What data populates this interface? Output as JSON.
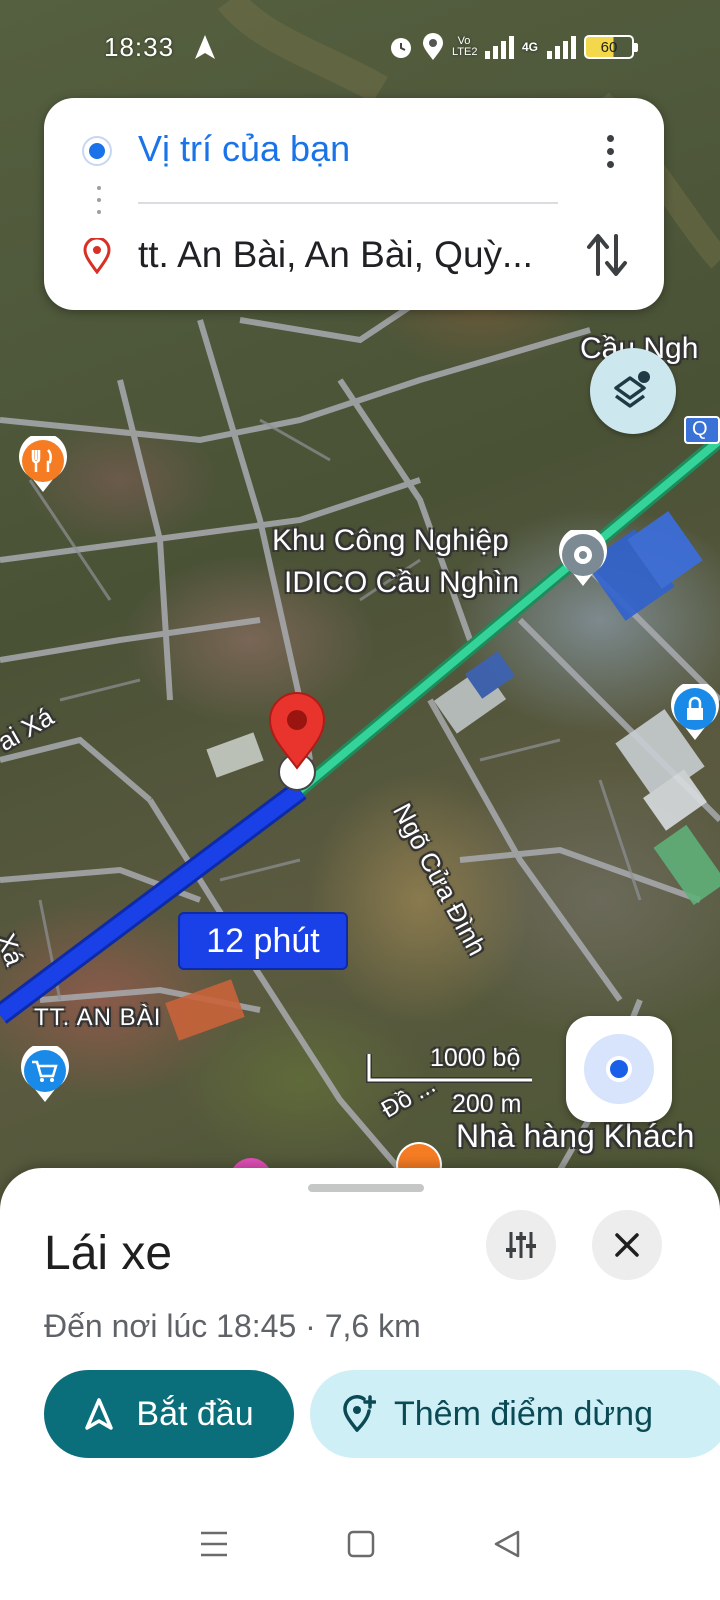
{
  "status_bar": {
    "time": "18:33",
    "network_label": "Vo LTE2",
    "net_type": "4G",
    "battery": "60"
  },
  "route": {
    "origin": "Vị trí của bạn",
    "destination": "tt. An Bài, An Bài, Quỳ..."
  },
  "map": {
    "labels": {
      "top_right": "Cầu Ngh",
      "industrial_line1": "Khu Công Nghiệp",
      "industrial_line2": "IDICO Cầu Nghìn",
      "left_road": "ai Xá",
      "left_road2": "Xá",
      "street": "Ngõ Cửa Đình",
      "town": "TT. AN BÀI",
      "road_bottom": "Đồ ...",
      "restaurant": "Nhà hàng Khách"
    },
    "duration_badge": "12 phút",
    "scale_imperial": "1000 bộ",
    "scale_metric": "200 m",
    "colors": {
      "route_blue": "#1a40e8",
      "route_green": "#2ecc8a",
      "pin_red": "#d93025"
    }
  },
  "sheet": {
    "mode": "Lái xe",
    "arrival": "Đến nơi lúc 18:45 · 7,6 km",
    "start_label": "Bắt đầu",
    "add_stop_label": "Thêm điểm dừng",
    "accent": "#0b6e7b"
  },
  "icons": [
    "navigation-arrow-icon",
    "alarm-icon",
    "location-icon",
    "signal-icon",
    "battery-icon",
    "more-vert-icon",
    "swap-vert-icon",
    "layers-icon",
    "my-location-icon",
    "tune-icon",
    "close-icon",
    "start-navigation-icon",
    "add-location-icon",
    "menu-icon",
    "home-icon",
    "back-icon"
  ]
}
